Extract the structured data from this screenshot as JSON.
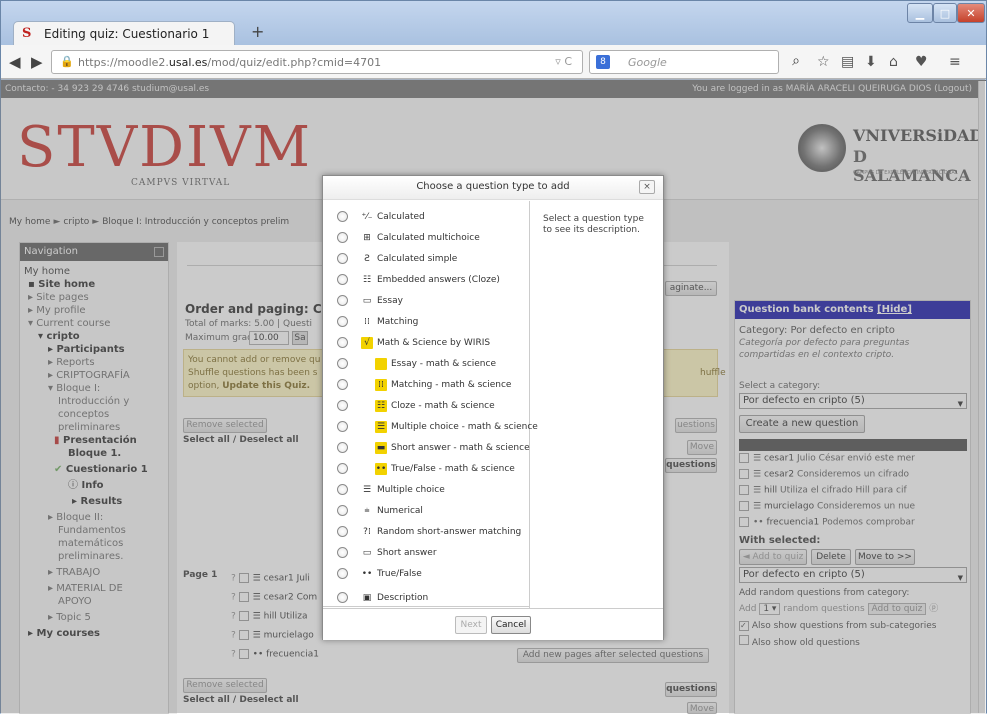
{
  "browser": {
    "tab_title": "Editing quiz: Cuestionario 1",
    "tab_favicon": "S",
    "url_prefix": "https://moodle2.",
    "url_domain": "usal.es",
    "url_path": "/mod/quiz/edit.php?cmid=4701",
    "search_placeholder": "Google",
    "search_engine_badge": "8"
  },
  "topstrip": {
    "contact": "Contacto: - 34 923 29 4746 studium@usal.es",
    "login": "You are logged in as MARÍA ARACELI QUEIRUGA DIOS (Logout)"
  },
  "header": {
    "logo": "STVDIVM",
    "logo_sub": "CAMPVS VIRTVAL",
    "univ_line1": "VNIVERSiDAD",
    "univ_line2": "D SALAMANCA",
    "univ_line3": "CAMPUS DE EXCELENCIA INTERNACIONAL"
  },
  "breadcrumb": [
    "My home",
    "cripto",
    "Bloque I: Introducción y conceptos prelim"
  ],
  "navigation": {
    "title": "Navigation",
    "items": [
      "My home",
      "Site home",
      "Site pages",
      "My profile",
      "Current course",
      "cripto",
      "Participants",
      "Reports",
      "CRIPTOGRAFÍA",
      "Bloque I:",
      "Introducción y",
      "conceptos",
      "preliminares",
      "Presentación",
      "Bloque 1.",
      "Cuestionario 1",
      "Info",
      "Results",
      "Bloque II:",
      "Fundamentos",
      "matemáticos",
      "preliminares.",
      "TRABAJO",
      "MATERIAL DE",
      "APOYO",
      "Topic 5",
      "My courses"
    ]
  },
  "main": {
    "order_title": "Order and paging: Cues",
    "marks": "Total of marks: 5.00 | Questi",
    "max_grade_label": "Maximum grade:",
    "max_grade_value": "10.00",
    "save_short": "Sa",
    "notice_line1": "You cannot add or remove qu",
    "notice_line2": "Shuffle questions has been s",
    "notice_line2_right": "huffle",
    "notice_line3a": "option,",
    "notice_line3b": "Update this Quiz.",
    "repaginate": "aginate...",
    "remove_selected": "Remove selected",
    "select_all": "Select all / Deselect all",
    "questions_btn": "uestions",
    "move_btn": "Move",
    "questions_btn2": "questions",
    "page_label": "Page 1",
    "questions": [
      "cesar1 Juli",
      "cesar2 Com",
      "hill Utiliza",
      "murcielago",
      "frecuencia1"
    ],
    "remove_selected_2": "Remove selected",
    "select_all_2": "Select all / Deselect all",
    "questions_btn3": "questions",
    "move_btn2": "Move",
    "add_pages": "Add new pages after selected questions"
  },
  "qbank": {
    "title": "Question bank contents",
    "hide": "[Hide]",
    "category": "Category: Por defecto en cripto",
    "category_desc": "Categoría por defecto para preguntas compartidas en el contexto cripto.",
    "select_label": "Select a category:",
    "select_value": "Por defecto en cripto (5)",
    "create": "Create a new question ...",
    "questions": [
      {
        "name": "cesar1",
        "text": "Julio César envió este mer"
      },
      {
        "name": "cesar2",
        "text": "Consideremos un cifrado"
      },
      {
        "name": "hill",
        "text": "Utiliza el cifrado Hill para cif"
      },
      {
        "name": "murcielago",
        "text": "Consideremos un nue"
      },
      {
        "name": "frecuencia1",
        "text": "Podemos comprobar"
      }
    ],
    "with_selected": "With selected:",
    "add_to_quiz": "◄ Add to quiz",
    "delete": "Delete",
    "move_to": "Move to >>",
    "move_select": "Por defecto en cripto (5)",
    "add_random": "Add random questions from category:",
    "add_label": "Add",
    "add_count": "1",
    "random_label": "random questions",
    "add_to_quiz2": "Add to quiz",
    "subcat": "Also show questions from sub-categories",
    "oldq": "Also show old questions"
  },
  "dialog": {
    "title": "Choose a question type to add",
    "close": "×",
    "description": "Select a question type to see its description.",
    "options": [
      {
        "label": "Calculated",
        "icon": "calculated-icon",
        "glyph": "⁺⁄₋",
        "ms": false
      },
      {
        "label": "Calculated multichoice",
        "icon": "calculated-multichoice-icon",
        "glyph": "⊞",
        "ms": false
      },
      {
        "label": "Calculated simple",
        "icon": "calculated-simple-icon",
        "glyph": "Ƨ",
        "ms": false
      },
      {
        "label": "Embedded answers (Cloze)",
        "icon": "cloze-icon",
        "glyph": "☷",
        "ms": false
      },
      {
        "label": "Essay",
        "icon": "essay-icon",
        "glyph": "▭",
        "ms": false
      },
      {
        "label": "Matching",
        "icon": "matching-icon",
        "glyph": "⁞⁞",
        "ms": false
      },
      {
        "label": "Math & Science by WIRIS",
        "icon": "wiris-icon",
        "glyph": "√",
        "ms": true
      },
      {
        "label": "Essay - math & science",
        "icon": "essay-ms-icon",
        "glyph": "",
        "ms": true
      },
      {
        "label": "Matching - math & science",
        "icon": "matching-ms-icon",
        "glyph": "⁞⁞",
        "ms": true
      },
      {
        "label": "Cloze - math & science",
        "icon": "cloze-ms-icon",
        "glyph": "☷",
        "ms": true
      },
      {
        "label": "Multiple choice - math & science",
        "icon": "multichoice-ms-icon",
        "glyph": "☰",
        "ms": true
      },
      {
        "label": "Short answer - math & science",
        "icon": "shortanswer-ms-icon",
        "glyph": "▬",
        "ms": true
      },
      {
        "label": "True/False - math & science",
        "icon": "truefalse-ms-icon",
        "glyph": "••",
        "ms": true
      },
      {
        "label": "Multiple choice",
        "icon": "multichoice-icon",
        "glyph": "☰",
        "ms": false
      },
      {
        "label": "Numerical",
        "icon": "numerical-icon",
        "glyph": "⩧",
        "ms": false
      },
      {
        "label": "Random short-answer matching",
        "icon": "random-matching-icon",
        "glyph": "?⁞",
        "ms": false
      },
      {
        "label": "Short answer",
        "icon": "shortanswer-icon",
        "glyph": "▭",
        "ms": false
      },
      {
        "label": "True/False",
        "icon": "truefalse-icon",
        "glyph": "••",
        "ms": false
      },
      {
        "label": "Description",
        "icon": "description-icon",
        "glyph": "▣",
        "ms": false
      }
    ],
    "next": "Next",
    "cancel": "Cancel"
  }
}
